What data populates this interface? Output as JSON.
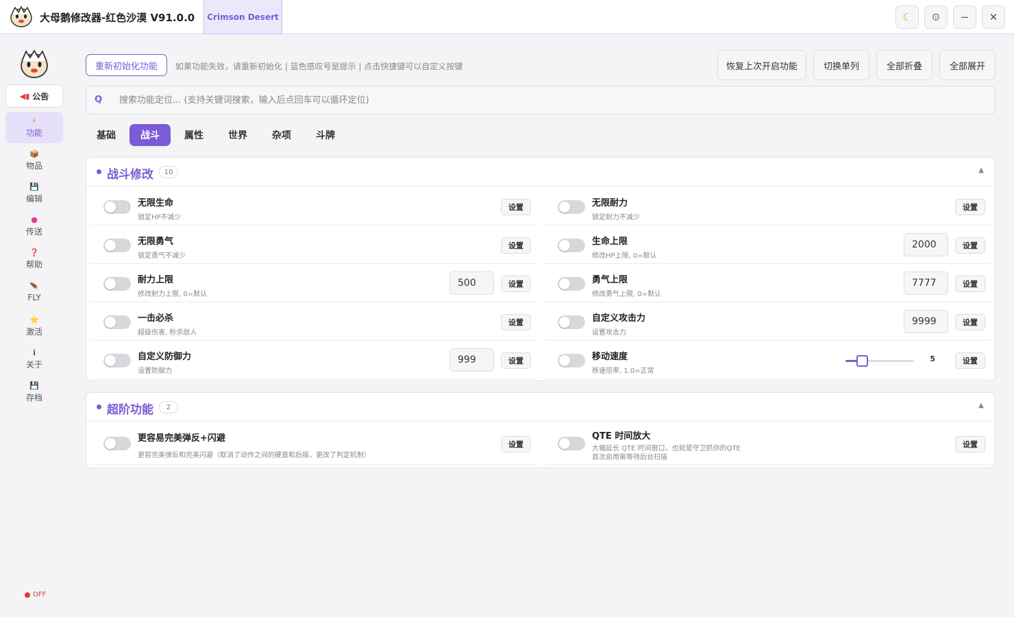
{
  "app": {
    "title": "大母鹅修改器-红色沙漠  V91.0.0",
    "game_tab": "Crimson Desert",
    "accent": "#7b5bd6"
  },
  "window_buttons": {
    "theme_icon": "moon-icon",
    "settings_icon": "gear-icon",
    "minimize": "−",
    "close": "✕"
  },
  "sidebar": {
    "notice": "公告",
    "items": [
      {
        "label": "功能",
        "icon": "⚡",
        "icon_name": "bolt-icon",
        "active": true
      },
      {
        "label": "物品",
        "icon": "📦",
        "icon_name": "box-icon"
      },
      {
        "label": "编辑",
        "icon": "💾",
        "icon_name": "save-icon"
      },
      {
        "label": "传送",
        "icon": "●",
        "icon_name": "teleport-icon"
      },
      {
        "label": "帮助",
        "icon": "❓",
        "icon_name": "help-icon"
      },
      {
        "label": "FLY",
        "icon": "🪶",
        "icon_name": "feather-icon"
      },
      {
        "label": "激活",
        "icon": "⭐",
        "icon_name": "star-icon"
      },
      {
        "label": "关于",
        "icon": "ℹ",
        "icon_name": "info-icon"
      },
      {
        "label": "存档",
        "icon": "💾",
        "icon_name": "save-icon"
      }
    ],
    "status": "OFF"
  },
  "toolbar": {
    "reinit": "重新初始化功能",
    "hint": "如果功能失效，请重新初始化 | 蓝色感叹号是提示 | 点击快捷键可以自定义按键",
    "buttons": [
      "恢复上次开启功能",
      "切换单列",
      "全部折叠",
      "全部展开"
    ]
  },
  "search": {
    "icon": "Q",
    "placeholder": "搜索功能定位... (支持关键词搜索，输入后点回车可以循环定位)"
  },
  "tabs": [
    "基础",
    "战斗",
    "属性",
    "世界",
    "杂项",
    "斗牌"
  ],
  "active_tab": 1,
  "sections": [
    {
      "title": "战斗修改",
      "count": "10",
      "collapse_icon": "▲",
      "rows": [
        {
          "name": "无限生命",
          "desc": "锁定HP不减少",
          "set": "设置"
        },
        {
          "name": "无限耐力",
          "desc": "锁定耐力不减少",
          "set": "设置"
        },
        {
          "name": "无限勇气",
          "desc": "锁定勇气不减少",
          "set": "设置"
        },
        {
          "name": "生命上限",
          "desc": "修改HP上限, 0=默认",
          "value": "2000",
          "set": "设置"
        },
        {
          "name": "耐力上限",
          "desc": "修改耐力上限, 0=默认",
          "value": "500",
          "set": "设置"
        },
        {
          "name": "勇气上限",
          "desc": "修改勇气上限, 0=默认",
          "value": "7777",
          "set": "设置"
        },
        {
          "name": "一击必杀",
          "desc": "超级伤害, 秒杀敌人",
          "set": "设置"
        },
        {
          "name": "自定义攻击力",
          "desc": "设置攻击力",
          "value": "9999",
          "set": "设置"
        },
        {
          "name": "自定义防御力",
          "desc": "设置防御力",
          "value": "999",
          "set": "设置"
        },
        {
          "name": "移动速度",
          "desc": "移速倍率, 1.0=正常",
          "slider_value": "5",
          "slider_fraction": 0.25,
          "set": "设置"
        }
      ]
    },
    {
      "title": "超阶功能",
      "count": "2",
      "collapse_icon": "▲",
      "rows": [
        {
          "name": "更容易完美弹反+闪避",
          "desc": "更容完美弹反和完美闪避（取消了动作之间的硬直和后摇，更改了判定机制）",
          "set": "设置"
        },
        {
          "name": "QTE 时间放大",
          "desc": "大幅延长 QTE 时间窗口，也就是守卫抓你的QTE",
          "desc2": "首次启用需等待后台扫描",
          "set": "设置"
        }
      ]
    }
  ]
}
